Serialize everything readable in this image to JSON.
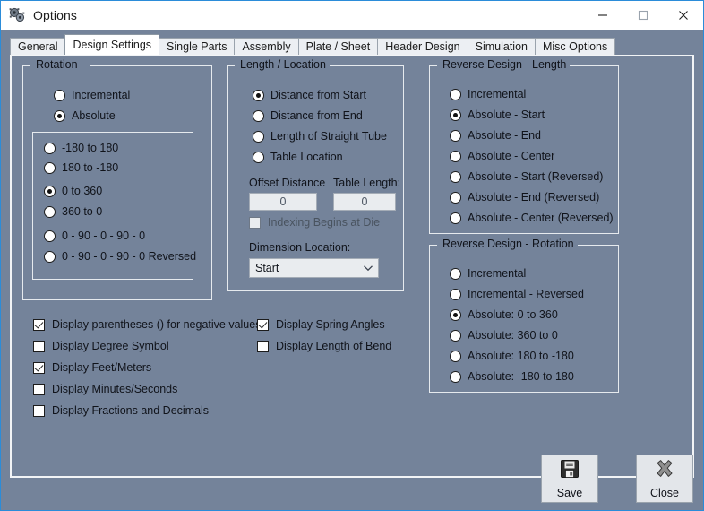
{
  "window": {
    "title": "Options",
    "icon": "gears-icon",
    "accent_border": "#2b8cd9",
    "body_bg": "#74839a",
    "minimize_label": "—",
    "maximize_label": "□",
    "close_label": "✕"
  },
  "tabs": [
    {
      "label": "General",
      "active": false
    },
    {
      "label": "Design Settings",
      "active": true
    },
    {
      "label": "Single Parts",
      "active": false
    },
    {
      "label": "Assembly",
      "active": false
    },
    {
      "label": "Plate / Sheet",
      "active": false
    },
    {
      "label": "Header Design",
      "active": false
    },
    {
      "label": "Simulation",
      "active": false
    },
    {
      "label": "Misc Options",
      "active": false
    }
  ],
  "rotation": {
    "title": "Rotation",
    "options": [
      {
        "label": "Incremental",
        "selected": false
      },
      {
        "label": "Absolute",
        "selected": true
      }
    ],
    "range_options": [
      {
        "label": "-180 to  180",
        "selected": false
      },
      {
        "label": "180 to  -180",
        "selected": false
      },
      {
        "label": "0 to  360",
        "selected": true
      },
      {
        "label": "360 to  0",
        "selected": false
      },
      {
        "label": "0 - 90 - 0 - 90 - 0",
        "selected": false
      },
      {
        "label": "0 - 90 - 0 - 90 - 0   Reversed",
        "selected": false
      }
    ]
  },
  "length_location": {
    "title": "Length / Location",
    "options": [
      {
        "label": "Distance from Start",
        "selected": true
      },
      {
        "label": "Distance from End",
        "selected": false
      },
      {
        "label": "Length of Straight Tube",
        "selected": false
      },
      {
        "label": "Table Location",
        "selected": false
      }
    ],
    "offset_distance_label": "Offset Distance",
    "offset_distance_value": "0",
    "table_length_label": "Table Length:",
    "table_length_value": "0",
    "indexing_checkbox_label": "Indexing Begins at Die",
    "indexing_checked": false,
    "dimension_location_label": "Dimension Location:",
    "dimension_location_value": "Start"
  },
  "reverse_design_length": {
    "title": "Reverse Design - Length",
    "options": [
      {
        "label": "Incremental",
        "selected": false
      },
      {
        "label": "Absolute - Start",
        "selected": true
      },
      {
        "label": "Absolute - End",
        "selected": false
      },
      {
        "label": "Absolute - Center",
        "selected": false
      },
      {
        "label": "Absolute - Start (Reversed)",
        "selected": false
      },
      {
        "label": "Absolute - End (Reversed)",
        "selected": false
      },
      {
        "label": "Absolute - Center (Reversed)",
        "selected": false
      }
    ]
  },
  "reverse_design_rotation": {
    "title": "Reverse Design - Rotation",
    "options": [
      {
        "label": "Incremental",
        "selected": false
      },
      {
        "label": "Incremental - Reversed",
        "selected": false
      },
      {
        "label": "Absolute:  0 to  360",
        "selected": true
      },
      {
        "label": "Absolute:  360 to  0",
        "selected": false
      },
      {
        "label": "Absolute:  180 to  -180",
        "selected": false
      },
      {
        "label": "Absolute:  -180 to  180",
        "selected": false
      }
    ]
  },
  "display_checkboxes_left": [
    {
      "label": "Display parentheses () for negative values",
      "checked": true
    },
    {
      "label": "Display Degree Symbol",
      "checked": false
    },
    {
      "label": "Display Feet/Meters",
      "checked": true
    },
    {
      "label": "Display Minutes/Seconds",
      "checked": false
    },
    {
      "label": "Display Fractions and Decimals",
      "checked": false
    }
  ],
  "display_checkboxes_right": [
    {
      "label": "Display Spring Angles",
      "checked": true
    },
    {
      "label": "Display Length of Bend",
      "checked": false
    }
  ],
  "buttons": {
    "save": {
      "label": "Save",
      "icon": "floppy-disk-icon"
    },
    "close": {
      "label": "Close",
      "icon": "x-cross-icon"
    }
  }
}
